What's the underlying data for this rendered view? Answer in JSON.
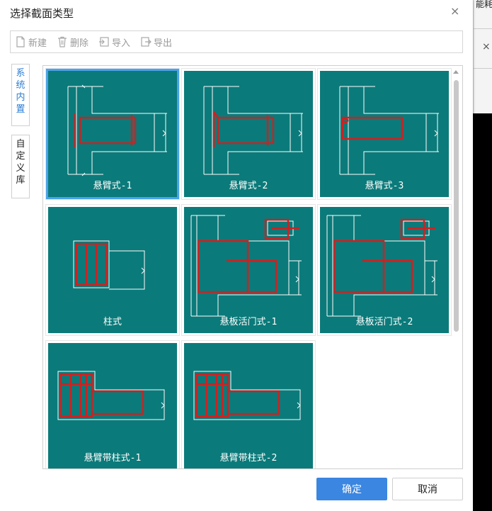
{
  "dialog": {
    "title": "选择截面类型",
    "close_icon": "×"
  },
  "toolbar": {
    "new_label": "新建",
    "delete_label": "删除",
    "import_label": "导入",
    "export_label": "导出"
  },
  "sidebar": {
    "tab_system": [
      "系",
      "统",
      "内",
      "置"
    ],
    "tab_custom": [
      "自",
      "定",
      "义",
      "库"
    ]
  },
  "items": [
    {
      "label": "悬臂式-1",
      "selected": true
    },
    {
      "label": "悬臂式-2",
      "selected": false
    },
    {
      "label": "悬臂式-3",
      "selected": false
    },
    {
      "label": "柱式",
      "selected": false
    },
    {
      "label": "悬板活门式-1",
      "selected": false
    },
    {
      "label": "悬板活门式-2",
      "selected": false
    },
    {
      "label": "悬臂带柱式-1",
      "selected": false
    },
    {
      "label": "悬臂带柱式-2",
      "selected": false
    }
  ],
  "footer": {
    "ok_label": "确定",
    "cancel_label": "取消"
  },
  "background_window": {
    "partial_text": "能耗",
    "close_icon": "×"
  },
  "colors": {
    "card_bg": "#0b7a7a",
    "rebar": "#d0201f",
    "selection": "#4aa3ea",
    "primary_button": "#3a86e0",
    "active_tab_text": "#2d7fd6"
  }
}
